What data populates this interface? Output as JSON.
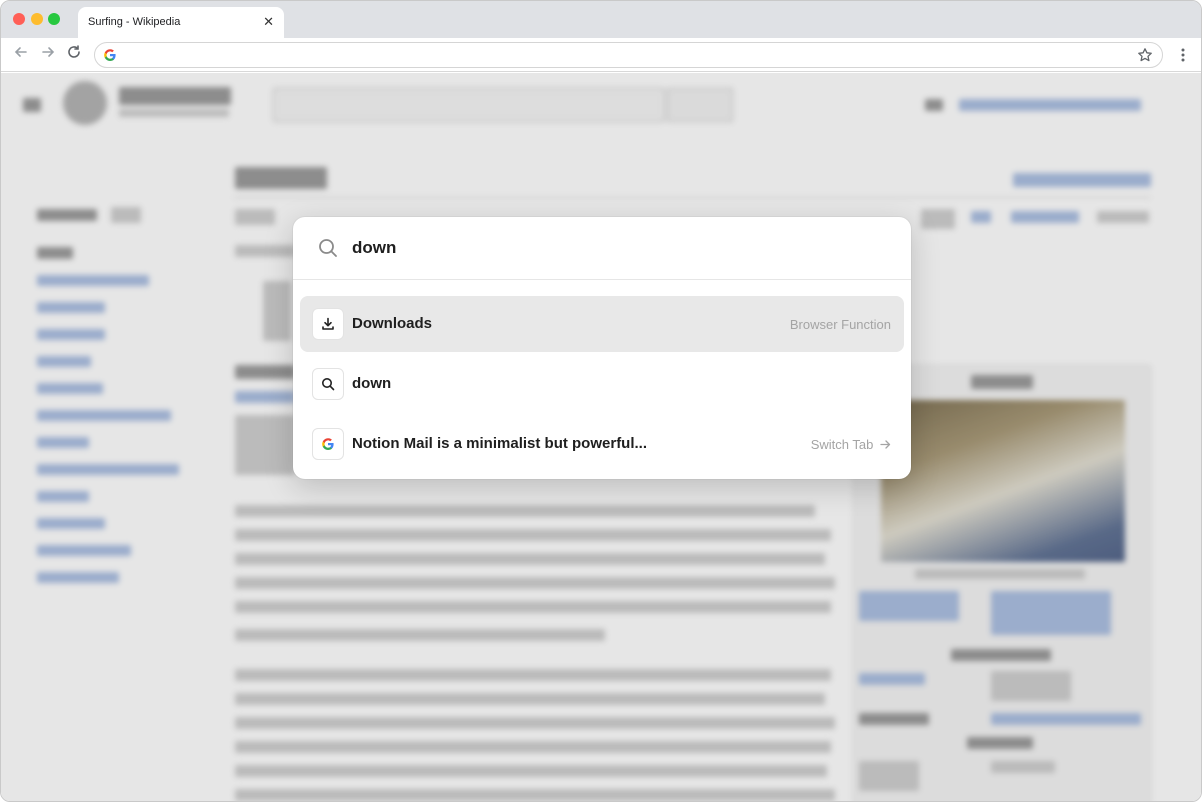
{
  "browser": {
    "tab": {
      "title": "Surfing - Wikipedia"
    },
    "omnibox": {
      "value": ""
    }
  },
  "palette": {
    "query": "down",
    "results": [
      {
        "label": "Downloads",
        "hint": "Browser Function",
        "icon": "download-icon",
        "selected": true
      },
      {
        "label": "down",
        "hint": "",
        "icon": "search-icon",
        "selected": false
      },
      {
        "label": "Notion Mail is a minimalist but powerful...",
        "hint": "Switch Tab",
        "icon": "google-icon",
        "selected": false
      }
    ]
  },
  "colors": {
    "selected_row": "#e8e8e8",
    "hint_text": "#a4a4a4",
    "tab_strip": "#dfe1e5"
  }
}
